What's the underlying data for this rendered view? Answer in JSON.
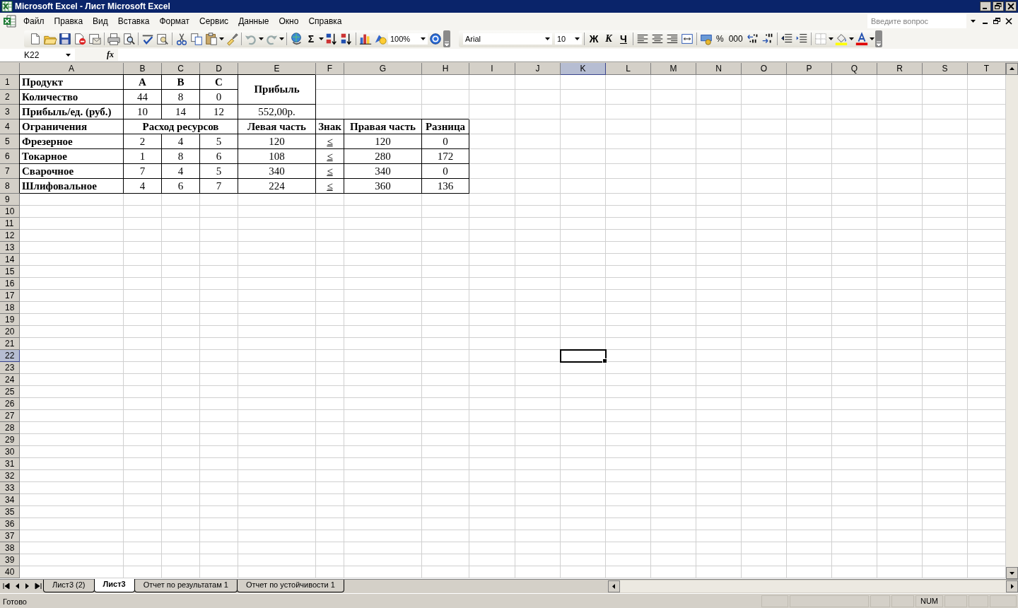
{
  "window": {
    "title": "Microsoft Excel - Лист Microsoft Excel"
  },
  "menu": [
    {
      "label": "Файл"
    },
    {
      "label": "Правка"
    },
    {
      "label": "Вид"
    },
    {
      "label": "Вставка"
    },
    {
      "label": "Формат"
    },
    {
      "label": "Сервис"
    },
    {
      "label": "Данные"
    },
    {
      "label": "Окно"
    },
    {
      "label": "Справка"
    }
  ],
  "help_box": {
    "placeholder": "Введите вопрос"
  },
  "toolbar": {
    "sum": "Σ",
    "zoom": "100%",
    "font": "Arial",
    "size": "10",
    "bold": "Ж",
    "italic": "К",
    "underline": "Ч",
    "percent": "%",
    "thousands": "000"
  },
  "formula_bar": {
    "name_box": "K22",
    "fx": "fx"
  },
  "columns": [
    {
      "label": "A",
      "selected": false
    },
    {
      "label": "B",
      "selected": false
    },
    {
      "label": "C",
      "selected": false
    },
    {
      "label": "D",
      "selected": false
    },
    {
      "label": "E",
      "selected": false
    },
    {
      "label": "F",
      "selected": false
    },
    {
      "label": "G",
      "selected": false
    },
    {
      "label": "H",
      "selected": false
    },
    {
      "label": "I",
      "selected": false
    },
    {
      "label": "J",
      "selected": false
    },
    {
      "label": "K",
      "selected": true
    },
    {
      "label": "L",
      "selected": false
    },
    {
      "label": "M",
      "selected": false
    },
    {
      "label": "N",
      "selected": false
    },
    {
      "label": "O",
      "selected": false
    },
    {
      "label": "P",
      "selected": false
    },
    {
      "label": "Q",
      "selected": false
    },
    {
      "label": "R",
      "selected": false
    },
    {
      "label": "S",
      "selected": false
    },
    {
      "label": "T",
      "selected": false
    }
  ],
  "rows": [
    {
      "label": "1",
      "selected": false,
      "cells": [
        {
          "text": "Продукт",
          "kind": "label"
        },
        {
          "text": "A",
          "kind": "header"
        },
        {
          "text": "B",
          "kind": "header"
        },
        {
          "text": "C",
          "kind": "header"
        },
        {
          "text": "Прибыль",
          "kind": "header"
        }
      ]
    },
    {
      "label": "2",
      "selected": false,
      "cells": [
        {
          "text": "Количество",
          "kind": "label"
        },
        {
          "text": "44",
          "kind": "value"
        },
        {
          "text": "8",
          "kind": "value"
        },
        {
          "text": "0",
          "kind": "value"
        }
      ]
    },
    {
      "label": "3",
      "selected": false,
      "cells": [
        {
          "text": "Прибыль/ед. (руб.)",
          "kind": "label"
        },
        {
          "text": "10",
          "kind": "value"
        },
        {
          "text": "14",
          "kind": "value"
        },
        {
          "text": "12",
          "kind": "value"
        },
        {
          "text": "552,00р.",
          "kind": "value"
        }
      ]
    },
    {
      "label": "4",
      "selected": false,
      "cells": [
        {
          "text": "Ограничения",
          "kind": "label"
        },
        {
          "text": "Расход ресурсов",
          "kind": "header"
        },
        {
          "text": "Левая часть",
          "kind": "header"
        },
        {
          "text": "Знак",
          "kind": "header"
        },
        {
          "text": "Правая часть",
          "kind": "header"
        },
        {
          "text": "Разница",
          "kind": "header"
        }
      ]
    },
    {
      "label": "5",
      "selected": false,
      "cells": [
        {
          "text": "Фрезерное",
          "kind": "label"
        },
        {
          "text": "2",
          "kind": "value"
        },
        {
          "text": "4",
          "kind": "value"
        },
        {
          "text": "5",
          "kind": "value"
        },
        {
          "text": "120",
          "kind": "value"
        },
        {
          "text": "≤",
          "kind": "value"
        },
        {
          "text": "120",
          "kind": "value"
        },
        {
          "text": "0",
          "kind": "value"
        }
      ]
    },
    {
      "label": "6",
      "selected": false,
      "cells": [
        {
          "text": "Токарное",
          "kind": "label"
        },
        {
          "text": "1",
          "kind": "value"
        },
        {
          "text": "8",
          "kind": "value"
        },
        {
          "text": "6",
          "kind": "value"
        },
        {
          "text": "108",
          "kind": "value"
        },
        {
          "text": "≤",
          "kind": "value"
        },
        {
          "text": "280",
          "kind": "value"
        },
        {
          "text": "172",
          "kind": "value"
        }
      ]
    },
    {
      "label": "7",
      "selected": false,
      "cells": [
        {
          "text": "Сварочное",
          "kind": "label"
        },
        {
          "text": "7",
          "kind": "value"
        },
        {
          "text": "4",
          "kind": "value"
        },
        {
          "text": "5",
          "kind": "value"
        },
        {
          "text": "340",
          "kind": "value"
        },
        {
          "text": "≤",
          "kind": "value"
        },
        {
          "text": "340",
          "kind": "value"
        },
        {
          "text": "0",
          "kind": "value"
        }
      ]
    },
    {
      "label": "8",
      "selected": false,
      "cells": [
        {
          "text": "Шлифовальное",
          "kind": "label"
        },
        {
          "text": "4",
          "kind": "value"
        },
        {
          "text": "6",
          "kind": "value"
        },
        {
          "text": "7",
          "kind": "value"
        },
        {
          "text": "224",
          "kind": "value"
        },
        {
          "text": "≤",
          "kind": "value"
        },
        {
          "text": "360",
          "kind": "value"
        },
        {
          "text": "136",
          "kind": "value"
        }
      ]
    },
    {
      "label": "9",
      "selected": false
    },
    {
      "label": "10",
      "selected": false
    },
    {
      "label": "11",
      "selected": false
    },
    {
      "label": "12",
      "selected": false
    },
    {
      "label": "13",
      "selected": false
    },
    {
      "label": "14",
      "selected": false
    },
    {
      "label": "15",
      "selected": false
    },
    {
      "label": "16",
      "selected": false
    },
    {
      "label": "17",
      "selected": false
    },
    {
      "label": "18",
      "selected": false
    },
    {
      "label": "19",
      "selected": false
    },
    {
      "label": "20",
      "selected": false
    },
    {
      "label": "21",
      "selected": false
    },
    {
      "label": "22",
      "selected": true
    },
    {
      "label": "23",
      "selected": false
    },
    {
      "label": "24",
      "selected": false
    },
    {
      "label": "25",
      "selected": false
    },
    {
      "label": "26",
      "selected": false
    },
    {
      "label": "27",
      "selected": false
    },
    {
      "label": "28",
      "selected": false
    },
    {
      "label": "29",
      "selected": false
    },
    {
      "label": "30",
      "selected": false
    },
    {
      "label": "31",
      "selected": false
    },
    {
      "label": "32",
      "selected": false
    },
    {
      "label": "33",
      "selected": false
    },
    {
      "label": "34",
      "selected": false
    },
    {
      "label": "35",
      "selected": false
    },
    {
      "label": "36",
      "selected": false
    },
    {
      "label": "37",
      "selected": false
    },
    {
      "label": "38",
      "selected": false
    },
    {
      "label": "39",
      "selected": false
    },
    {
      "label": "40",
      "selected": false
    }
  ],
  "sheet_tabs": [
    {
      "label": "Лист3 (2)",
      "selected": false
    },
    {
      "label": "Лист3",
      "selected": true
    },
    {
      "label": "Отчет по результатам 1",
      "selected": false
    },
    {
      "label": "Отчет по устойчивости 1",
      "selected": false
    }
  ],
  "status_bar": {
    "text": "Готово",
    "indicator": "NUM"
  }
}
